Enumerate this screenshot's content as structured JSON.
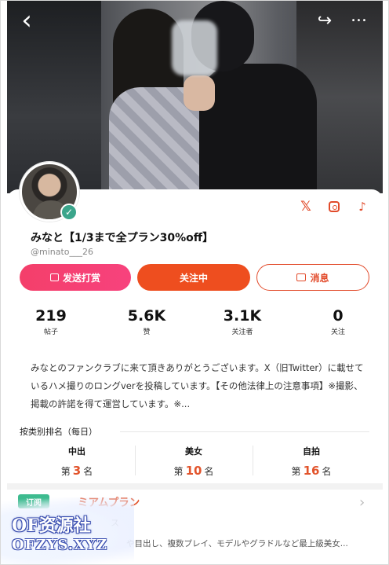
{
  "nav": {
    "back_icon": "chevron-left-icon",
    "share_icon": "share-arrow-icon",
    "more_icon": "more-dots-icon",
    "back_glyph": "‹",
    "share_glyph": "↪",
    "more_glyph": "•••"
  },
  "profile": {
    "name": "みなと【1/3まで全プラン30%off】",
    "handle": "@minato___26",
    "verified": true,
    "verified_glyph": "✓",
    "social_links": [
      {
        "icon": "x-icon",
        "glyph": "𝕏"
      },
      {
        "icon": "instagram-icon"
      },
      {
        "icon": "tiktok-icon",
        "glyph": "♪"
      }
    ]
  },
  "actions": {
    "gift_label": "发送打赏",
    "follow_label": "关注中",
    "message_label": "消息"
  },
  "stats": [
    {
      "value": "219",
      "label": "帖子"
    },
    {
      "value": "5.6K",
      "label": "赞"
    },
    {
      "value": "3.1K",
      "label": "关注者"
    },
    {
      "value": "0",
      "label": "关注"
    }
  ],
  "bio": "みなとのファンクラブに来て頂きありがとうございます。X（旧Twitter）に載せているハメ撮りのロングverを投稿しています。【その他法律上の注意事項】※撮影、掲載の許諾を得て運営しています。※...",
  "ranking": {
    "heading": "按类别排名（每日）",
    "items": [
      {
        "category": "中出",
        "prefix": "第",
        "rank": "3",
        "suffix": "名"
      },
      {
        "category": "美女",
        "prefix": "第",
        "rank": "10",
        "suffix": "名"
      },
      {
        "category": "自拍",
        "prefix": "第",
        "rank": "16",
        "suffix": "名"
      }
    ]
  },
  "plan": {
    "badge": "订阅",
    "title": "ミアムプラン",
    "subtitle": "ス",
    "description": "や目出し、複数プレイ、モデルやグラドルなど最上級美女...",
    "chevron_glyph": "›"
  },
  "watermark": {
    "line1": "OF资源社",
    "line2": "OFZYS.XYZ"
  },
  "colors": {
    "accent": "#ee4e1f",
    "gift": "#f43f6a",
    "rank_number": "#e2542c",
    "verified": "#3ba58b",
    "plan_badge": "#3dbb8f"
  }
}
